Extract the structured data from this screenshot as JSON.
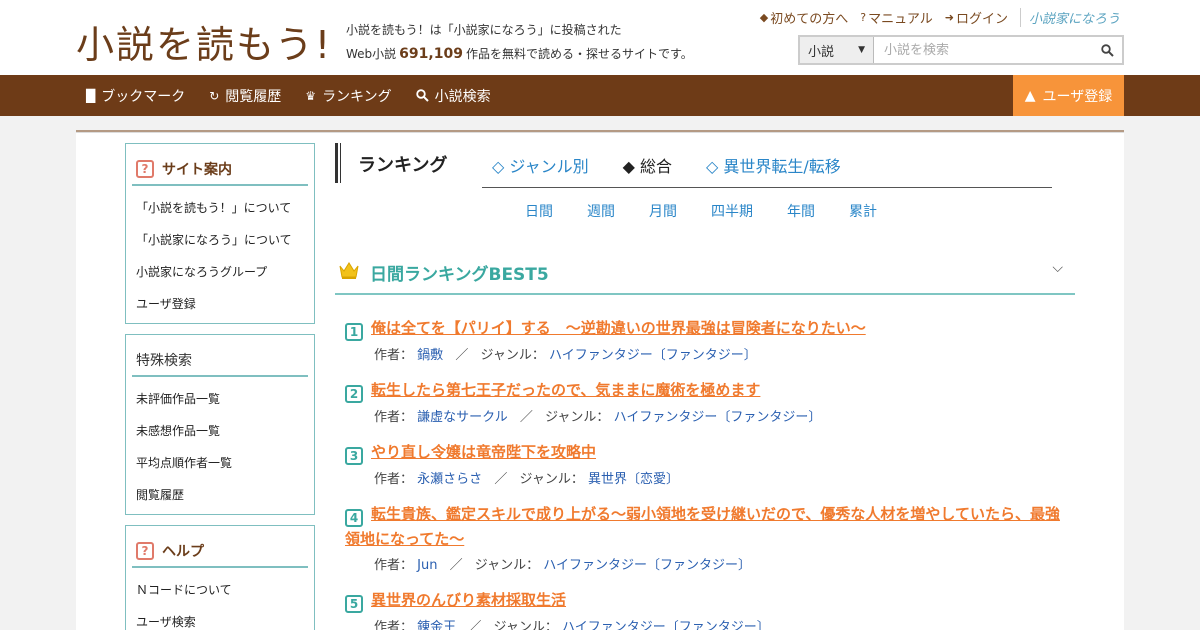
{
  "header": {
    "logo": "小説を読もう!",
    "tagline_line1": "小説を読もう！は「小説家になろう」に投稿された",
    "tagline_prefix": "Web小説",
    "tagline_count": "691,109",
    "tagline_suffix": "作品を無料で読める・探せるサイトです。",
    "top_links": {
      "beginner": "初めての方へ",
      "manual": "マニュアル",
      "login": "ログイン",
      "brand": "小説家になろう"
    },
    "search": {
      "category": "小説",
      "placeholder": "小説を検索"
    }
  },
  "nav": {
    "bookmark": "ブックマーク",
    "history": "閲覧履歴",
    "ranking": "ランキング",
    "search": "小説検索",
    "register": "ユーザ登録"
  },
  "sidebar": {
    "guide": {
      "title": "サイト案内",
      "items": [
        "「小説を読もう！」について",
        "「小説家になろう」について",
        "小説家になろうグループ",
        "ユーザ登録"
      ]
    },
    "special": {
      "title": "特殊検索",
      "items": [
        "未評価作品一覧",
        "未感想作品一覧",
        "平均点順作者一覧",
        "閲覧履歴"
      ]
    },
    "help": {
      "title": "ヘルプ",
      "items": [
        "Ｎコードについて",
        "ユーザ検索"
      ]
    }
  },
  "main": {
    "ranking_title": "ランキング",
    "tabs": [
      "◇ ジャンル別",
      "◆ 総合",
      "◇ 異世界転生/転移"
    ],
    "periods": [
      "日間",
      "週間",
      "月間",
      "四半期",
      "年間",
      "累計"
    ],
    "best_title": "日間ランキングBEST5",
    "author_label": "作者：",
    "genre_label": "ジャンル：",
    "separator": "／",
    "items": [
      {
        "num": "1",
        "title": "俺は全てを【パリイ】する　〜逆勘違いの世界最強は冒険者になりたい〜",
        "author": "鍋敷",
        "genre": "ハイファンタジー〔ファンタジー〕"
      },
      {
        "num": "2",
        "title": "転生したら第七王子だったので、気ままに魔術を極めます",
        "author": "謙虚なサークル",
        "genre": "ハイファンタジー〔ファンタジー〕"
      },
      {
        "num": "3",
        "title": "やり直し令嬢は竜帝陛下を攻略中",
        "author": "永瀬さらさ",
        "genre": "異世界〔恋愛〕"
      },
      {
        "num": "4",
        "title": "転生貴族、鑑定スキルで成り上がる～弱小領地を受け継いだので、優秀な人材を増やしていたら、最強領地になってた～",
        "author": "Jun",
        "genre": "ハイファンタジー〔ファンタジー〕"
      },
      {
        "num": "5",
        "title": "異世界のんびり素材採取生活",
        "author": "錬金王",
        "genre": "ハイファンタジー〔ファンタジー〕"
      }
    ]
  },
  "colors": {
    "brown": "#6e3b17",
    "orange": "#f7943a",
    "teal": "#3aa8a0",
    "link_blue": "#2a86c8",
    "title_orange": "#f07a2e"
  }
}
